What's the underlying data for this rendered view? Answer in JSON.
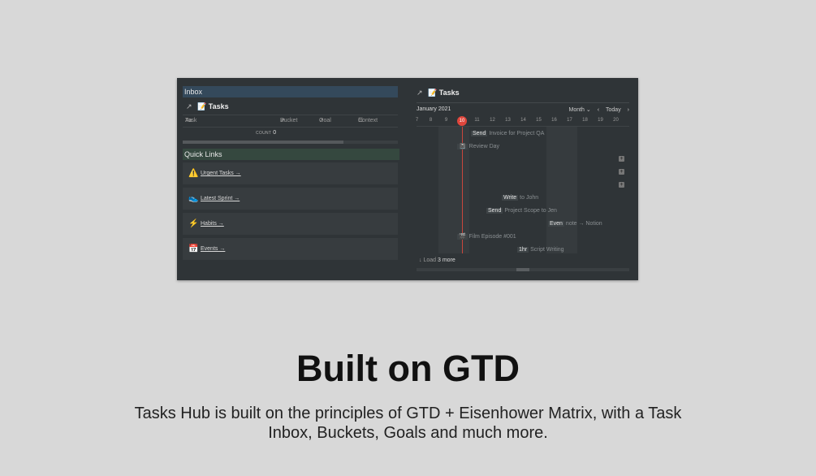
{
  "left": {
    "inbox_header": "Inbox",
    "db_title": "Tasks",
    "db_emoji": "📝",
    "arrow": "↗",
    "columns": [
      {
        "icon": "Aa",
        "label": "Task"
      },
      {
        "icon": "↗",
        "label": "Bucket"
      },
      {
        "icon": "↗",
        "label": "Goal"
      },
      {
        "icon": "☰",
        "label": "Context"
      }
    ],
    "count_label": "COUNT",
    "count_value": "0",
    "quick_links_header": "Quick Links",
    "quick_links": [
      {
        "icon": "⚠️",
        "label": "Urgent Tasks →"
      },
      {
        "icon": "👟",
        "label": "Latest Sprint →"
      },
      {
        "icon": "⚡",
        "label": "Habits →"
      },
      {
        "icon": "📅",
        "label": "Events →"
      }
    ]
  },
  "right": {
    "arrow": "↗",
    "title": "Tasks",
    "emoji": "📝",
    "month": "January 2021",
    "view": "Month ⌄",
    "prev": "‹",
    "today": "Today",
    "next": "›",
    "days": [
      "8",
      "9",
      "10",
      "11",
      "12",
      "13",
      "14",
      "15",
      "16",
      "17",
      "18",
      "19",
      "20"
    ],
    "today_day": "10",
    "events": [
      {
        "pill": "Send",
        "rest": "Invoice for Project QA"
      },
      {
        "pill": "📓",
        "rest": "Review Day"
      },
      {
        "pill": "Write",
        "rest": "to John"
      },
      {
        "pill": "Send",
        "rest": "Project Scope to Jen"
      },
      {
        "pill": "Even",
        "rest": "note → Notion"
      },
      {
        "pill": "🎬",
        "rest": "Film Episode #001"
      },
      {
        "pill": "1hr",
        "rest": "Script Writing"
      }
    ],
    "load_prefix": "Load",
    "load_count": "3 more"
  },
  "headline": "Built on GTD",
  "subtitle": "Tasks Hub is built on the principles of GTD + Eisenhower Matrix, with a Task Inbox, Buckets, Goals and much more."
}
